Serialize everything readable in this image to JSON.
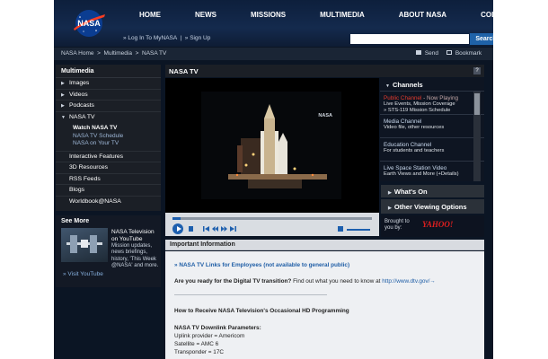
{
  "header": {
    "logo_text": "NASA",
    "nav": [
      "HOME",
      "NEWS",
      "MISSIONS",
      "MULTIMEDIA",
      "ABOUT NASA",
      "COLLABORATE"
    ],
    "login": "» Log In To MyNASA",
    "signup": "» Sign Up",
    "search_placeholder": "",
    "search_button": "Search"
  },
  "breadcrumb": {
    "items": [
      "NASA Home",
      "Multimedia",
      "NASA TV"
    ],
    "separator": ">",
    "send": "Send",
    "bookmark": "Bookmark"
  },
  "sidebar": {
    "title": "Multimedia",
    "items": [
      "Images",
      "Videos",
      "Podcasts",
      "NASA TV"
    ],
    "subitems": [
      "Watch NASA TV",
      "NASA TV Schedule",
      "NASA on Your TV"
    ],
    "items_after": [
      "Interactive Features",
      "3D Resources",
      "RSS Feeds",
      "Blogs",
      "Worldbook@NASA"
    ]
  },
  "see_more": {
    "title": "See More",
    "heading": "NASA Television on YouTube",
    "text": "Mission updates, news briefings, history, 'This Week @NASA' and more.",
    "link": "» Visit YouTube"
  },
  "panel": {
    "title": "NASA TV",
    "help": "?",
    "watermark": "NASA"
  },
  "player": {
    "progress_fraction": 0.04
  },
  "channels": {
    "title": "Channels",
    "list": [
      {
        "name": "Public Channel",
        "now": " - Now Playing",
        "desc_1": "Live Events, Mission Coverage",
        "desc_2": "» STS-119 Mission Schedule"
      },
      {
        "name": "Media Channel",
        "now": "",
        "desc_1": "Video file, other resources",
        "desc_2": ""
      },
      {
        "name": "Education Channel",
        "now": "",
        "desc_1": "For students and teachers",
        "desc_2": ""
      },
      {
        "name": "Live Space Station Video",
        "now": "",
        "desc_1": "Earth Views and More (+Details)",
        "desc_2": ""
      }
    ],
    "whats_on": "What's On",
    "other_options": "Other Viewing Options",
    "brought_by": "Brought to you by:",
    "sponsor": "YAHOO!"
  },
  "info": {
    "title": "Important Information",
    "link_1": "» NASA TV Links for Employees (not available to general public)",
    "question": "Are you ready for the Digital TV transition?",
    "question_rest": " Find out what you need to know at ",
    "dtv_link": "http://www.dtv.gov/",
    "hd_heading": "How to Receive NASA Television's Occasional HD Programming",
    "params_heading": "NASA TV Downlink Parameters:",
    "params": [
      "Uplink provider = Americom",
      "Satellite = AMC 6",
      "Transponder = 17C"
    ]
  },
  "colors": {
    "accent": "#1d5fae",
    "live_red": "#e33b2e",
    "background": "#0b1524"
  }
}
